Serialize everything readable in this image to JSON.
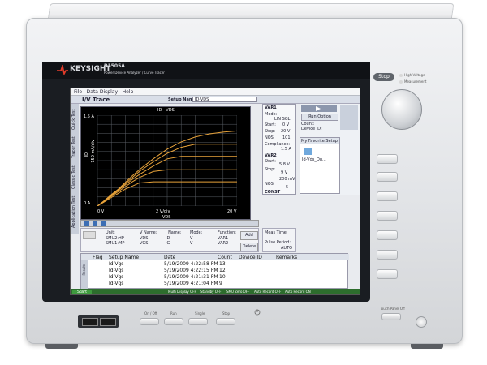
{
  "instrument": {
    "brand": "KEYSIGHT",
    "model": "B1505A",
    "model_subtitle": "Power Device Analyzer / Curve Tracer",
    "stop_label": "Stop",
    "indicator_high_voltage": "High Voltage",
    "indicator_measurement": "Measurement"
  },
  "menu": [
    "File",
    "Data Display",
    "Help"
  ],
  "app": {
    "title": "I/V Trace",
    "setup_name_label": "Setup Name:",
    "setup_name_value": "ID-VDS",
    "left_tabs": [
      "Application Test",
      "Classic Test",
      "Tracer Test",
      "Quick Test"
    ]
  },
  "graph": {
    "title": "ID - VDS",
    "y_top": "1.5 A",
    "y_mid": "150 mA/div",
    "y_bottom": "0 A",
    "x_left": "0 V",
    "x_mid": "2 V/div",
    "x_right": "20 V",
    "x_name": "VDS",
    "y_name": "ID",
    "trace_color": "#e8a33a",
    "grid_color": "#5a5f66"
  },
  "chart_data": {
    "type": "line",
    "title": "ID - VDS",
    "xlabel": "VDS",
    "ylabel": "ID",
    "xlim": [
      0,
      20
    ],
    "ylim": [
      0,
      1.5
    ],
    "grid": true,
    "x": [
      0,
      1,
      2,
      3,
      4,
      5,
      6,
      8,
      10,
      12,
      14,
      16,
      18,
      20
    ],
    "series": [
      {
        "values": [
          0,
          0.07,
          0.14,
          0.21,
          0.28,
          0.33,
          0.38,
          0.4,
          0.4,
          0.4,
          0.4,
          0.4,
          0.4,
          0.4
        ]
      },
      {
        "values": [
          0,
          0.08,
          0.16,
          0.24,
          0.32,
          0.4,
          0.47,
          0.57,
          0.6,
          0.6,
          0.6,
          0.6,
          0.6,
          0.6
        ]
      },
      {
        "values": [
          0,
          0.08,
          0.17,
          0.26,
          0.35,
          0.44,
          0.52,
          0.66,
          0.78,
          0.82,
          0.82,
          0.82,
          0.82,
          0.82
        ]
      },
      {
        "values": [
          0,
          0.09,
          0.18,
          0.27,
          0.37,
          0.47,
          0.57,
          0.73,
          0.87,
          0.97,
          1.02,
          1.02,
          1.02,
          1.02
        ]
      },
      {
        "values": [
          0,
          0.09,
          0.19,
          0.28,
          0.39,
          0.5,
          0.6,
          0.78,
          0.94,
          1.06,
          1.14,
          1.19,
          1.22,
          1.24
        ]
      }
    ]
  },
  "params": {
    "var1": "VAR1",
    "mode_label": "Mode:",
    "mode_value": "LIN SGL",
    "start_label": "Start:",
    "start_value": "0 V",
    "stop_label": "Stop:",
    "stop_value": "20 V",
    "nos_label": "NOS:",
    "nos_value": "101",
    "compliance_label": "Compliance:",
    "compliance_value": "1.5 A",
    "var2": "VAR2",
    "var2_start": "5.8 V",
    "var2_stop": "9 V",
    "var2_step": "200 mV",
    "var2_nos": "5",
    "const": "CONST"
  },
  "right_panel": {
    "run_option": "Run Option",
    "count_label": "Count:",
    "device_id_label": "Device ID:",
    "favorite_setup": "My Favorite Setup",
    "favorite_item": "Id-Vds_Qu..."
  },
  "unit_table": {
    "headers": [
      "Unit:",
      "V Name:",
      "I Name:",
      "Mode:",
      "Function:"
    ],
    "row1": [
      "SMU2:HP",
      "VDS",
      "ID",
      "V",
      "VAR1"
    ],
    "row2": [
      "SMU1:MP",
      "VGS",
      "IG",
      "V",
      "VAR2"
    ],
    "add_label": "Add",
    "delete_label": "Delete"
  },
  "meas": {
    "meas_time_label": "Meas Time:",
    "pulse_period_label": "Pulse Period:",
    "pulse_value": "AUTO"
  },
  "results": {
    "tab_label": "Results",
    "headers": [
      "Flag",
      "Setup Name",
      "Date",
      "Count",
      "Device ID",
      "Remarks"
    ],
    "rows": [
      [
        "",
        "Id-Vgs",
        "5/19/2009 4:22:58 PM",
        "13",
        "",
        ""
      ],
      [
        "",
        "Id-Vgs",
        "5/19/2009 4:22:15 PM",
        "12",
        "",
        ""
      ],
      [
        "",
        "Id-Vgs",
        "5/19/2009 4:21:31 PM",
        "10",
        "",
        ""
      ],
      [
        "",
        "Id-Vgs",
        "5/19/2009 4:21:04 PM",
        "9",
        "",
        ""
      ]
    ]
  },
  "status": {
    "start_label": "Start",
    "items": [
      "Multi Display OFF",
      "Standby OFF",
      "SMU Zero OFF",
      "Auto Record OFF",
      "Auto Record ON"
    ]
  },
  "front_panel": {
    "button_labels": [
      "On / Off",
      "Run",
      "Single",
      "Stop"
    ],
    "power_label": "Touch Panel Off"
  }
}
